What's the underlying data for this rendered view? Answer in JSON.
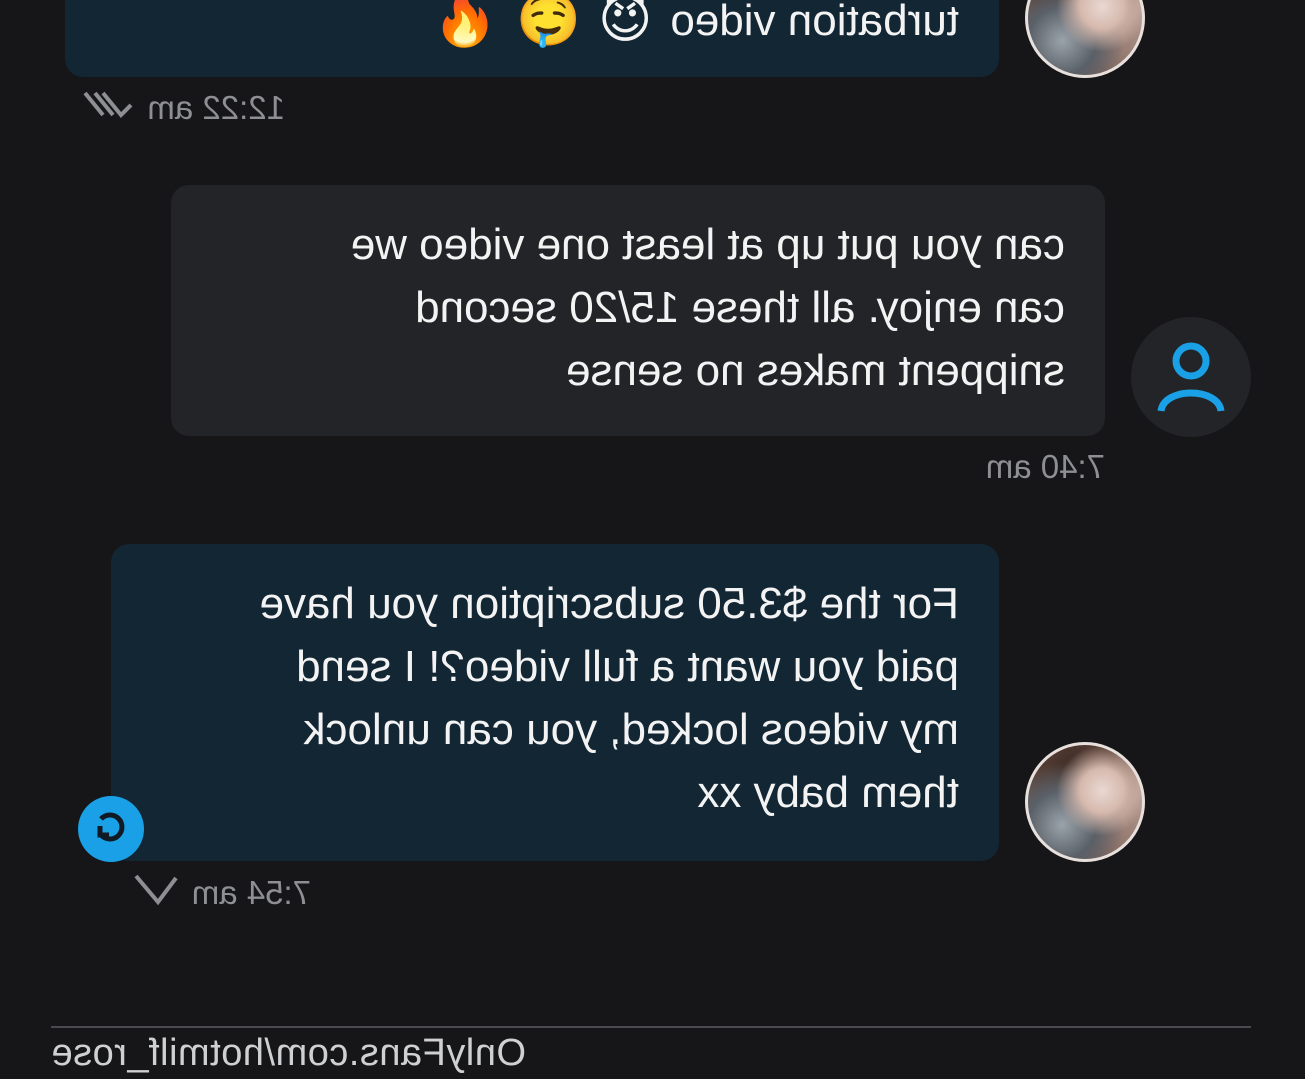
{
  "messages": [
    {
      "text_line": "turbation video",
      "emojis": [
        "😈",
        "🤤",
        "🔥"
      ],
      "time": "12:22 am",
      "status_icon": "double-check-icon"
    },
    {
      "lines": [
        "can you put up at least one video we",
        "can enjoy. all these 15/20 second",
        "snippent makes no sense"
      ],
      "time": "7:40 am"
    },
    {
      "lines": [
        "For the $3.50 subscription you have",
        "paid you want a full video?! I send",
        "my videos locked, you can unlock",
        "them baby xx"
      ],
      "time": "7:54 am",
      "status_icon": "check-icon"
    }
  ],
  "watermark": "OnlyFans.com/hotmilf_rose",
  "colors": {
    "background": "#161618",
    "outgoing_bubble": "#122634",
    "incoming_bubble": "#232427",
    "accent": "#1aa0e6"
  }
}
